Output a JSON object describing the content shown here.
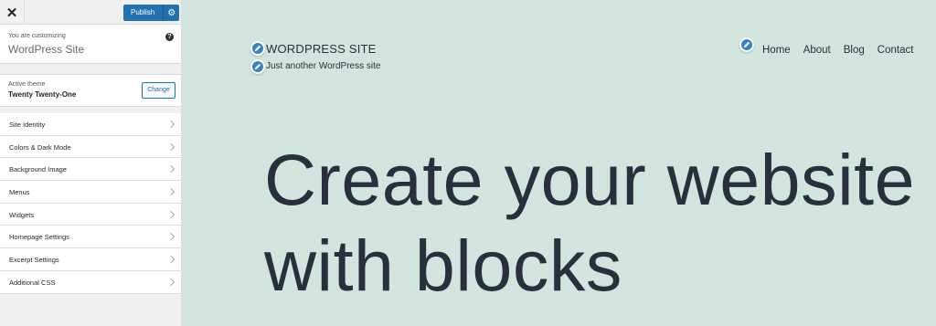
{
  "sidebar": {
    "close_icon": "close-icon",
    "publish_label": "Publish",
    "publish_settings_icon": "gear-icon",
    "customizing_label": "You are customizing",
    "site_title": "WordPress Site",
    "help_icon_glyph": "?",
    "active_theme_label": "Active theme",
    "theme_name": "Twenty Twenty-One",
    "change_label": "Change",
    "panels": [
      {
        "label": "Site Identity"
      },
      {
        "label": "Colors & Dark Mode"
      },
      {
        "label": "Background Image"
      },
      {
        "label": "Menus"
      },
      {
        "label": "Widgets"
      },
      {
        "label": "Homepage Settings"
      },
      {
        "label": "Excerpt Settings"
      },
      {
        "label": "Additional CSS"
      }
    ]
  },
  "preview": {
    "site_name": "WORDPRESS SITE",
    "tagline": "Just another WordPress site",
    "nav": [
      "Home",
      "About",
      "Blog",
      "Contact"
    ],
    "hero_line1": "Create your website",
    "hero_line2": "with blocks",
    "background_color": "#d1e4dd",
    "text_color": "#28303d"
  },
  "colors": {
    "accent": "#2271b1",
    "edit_shortcut": "#3582c4"
  }
}
